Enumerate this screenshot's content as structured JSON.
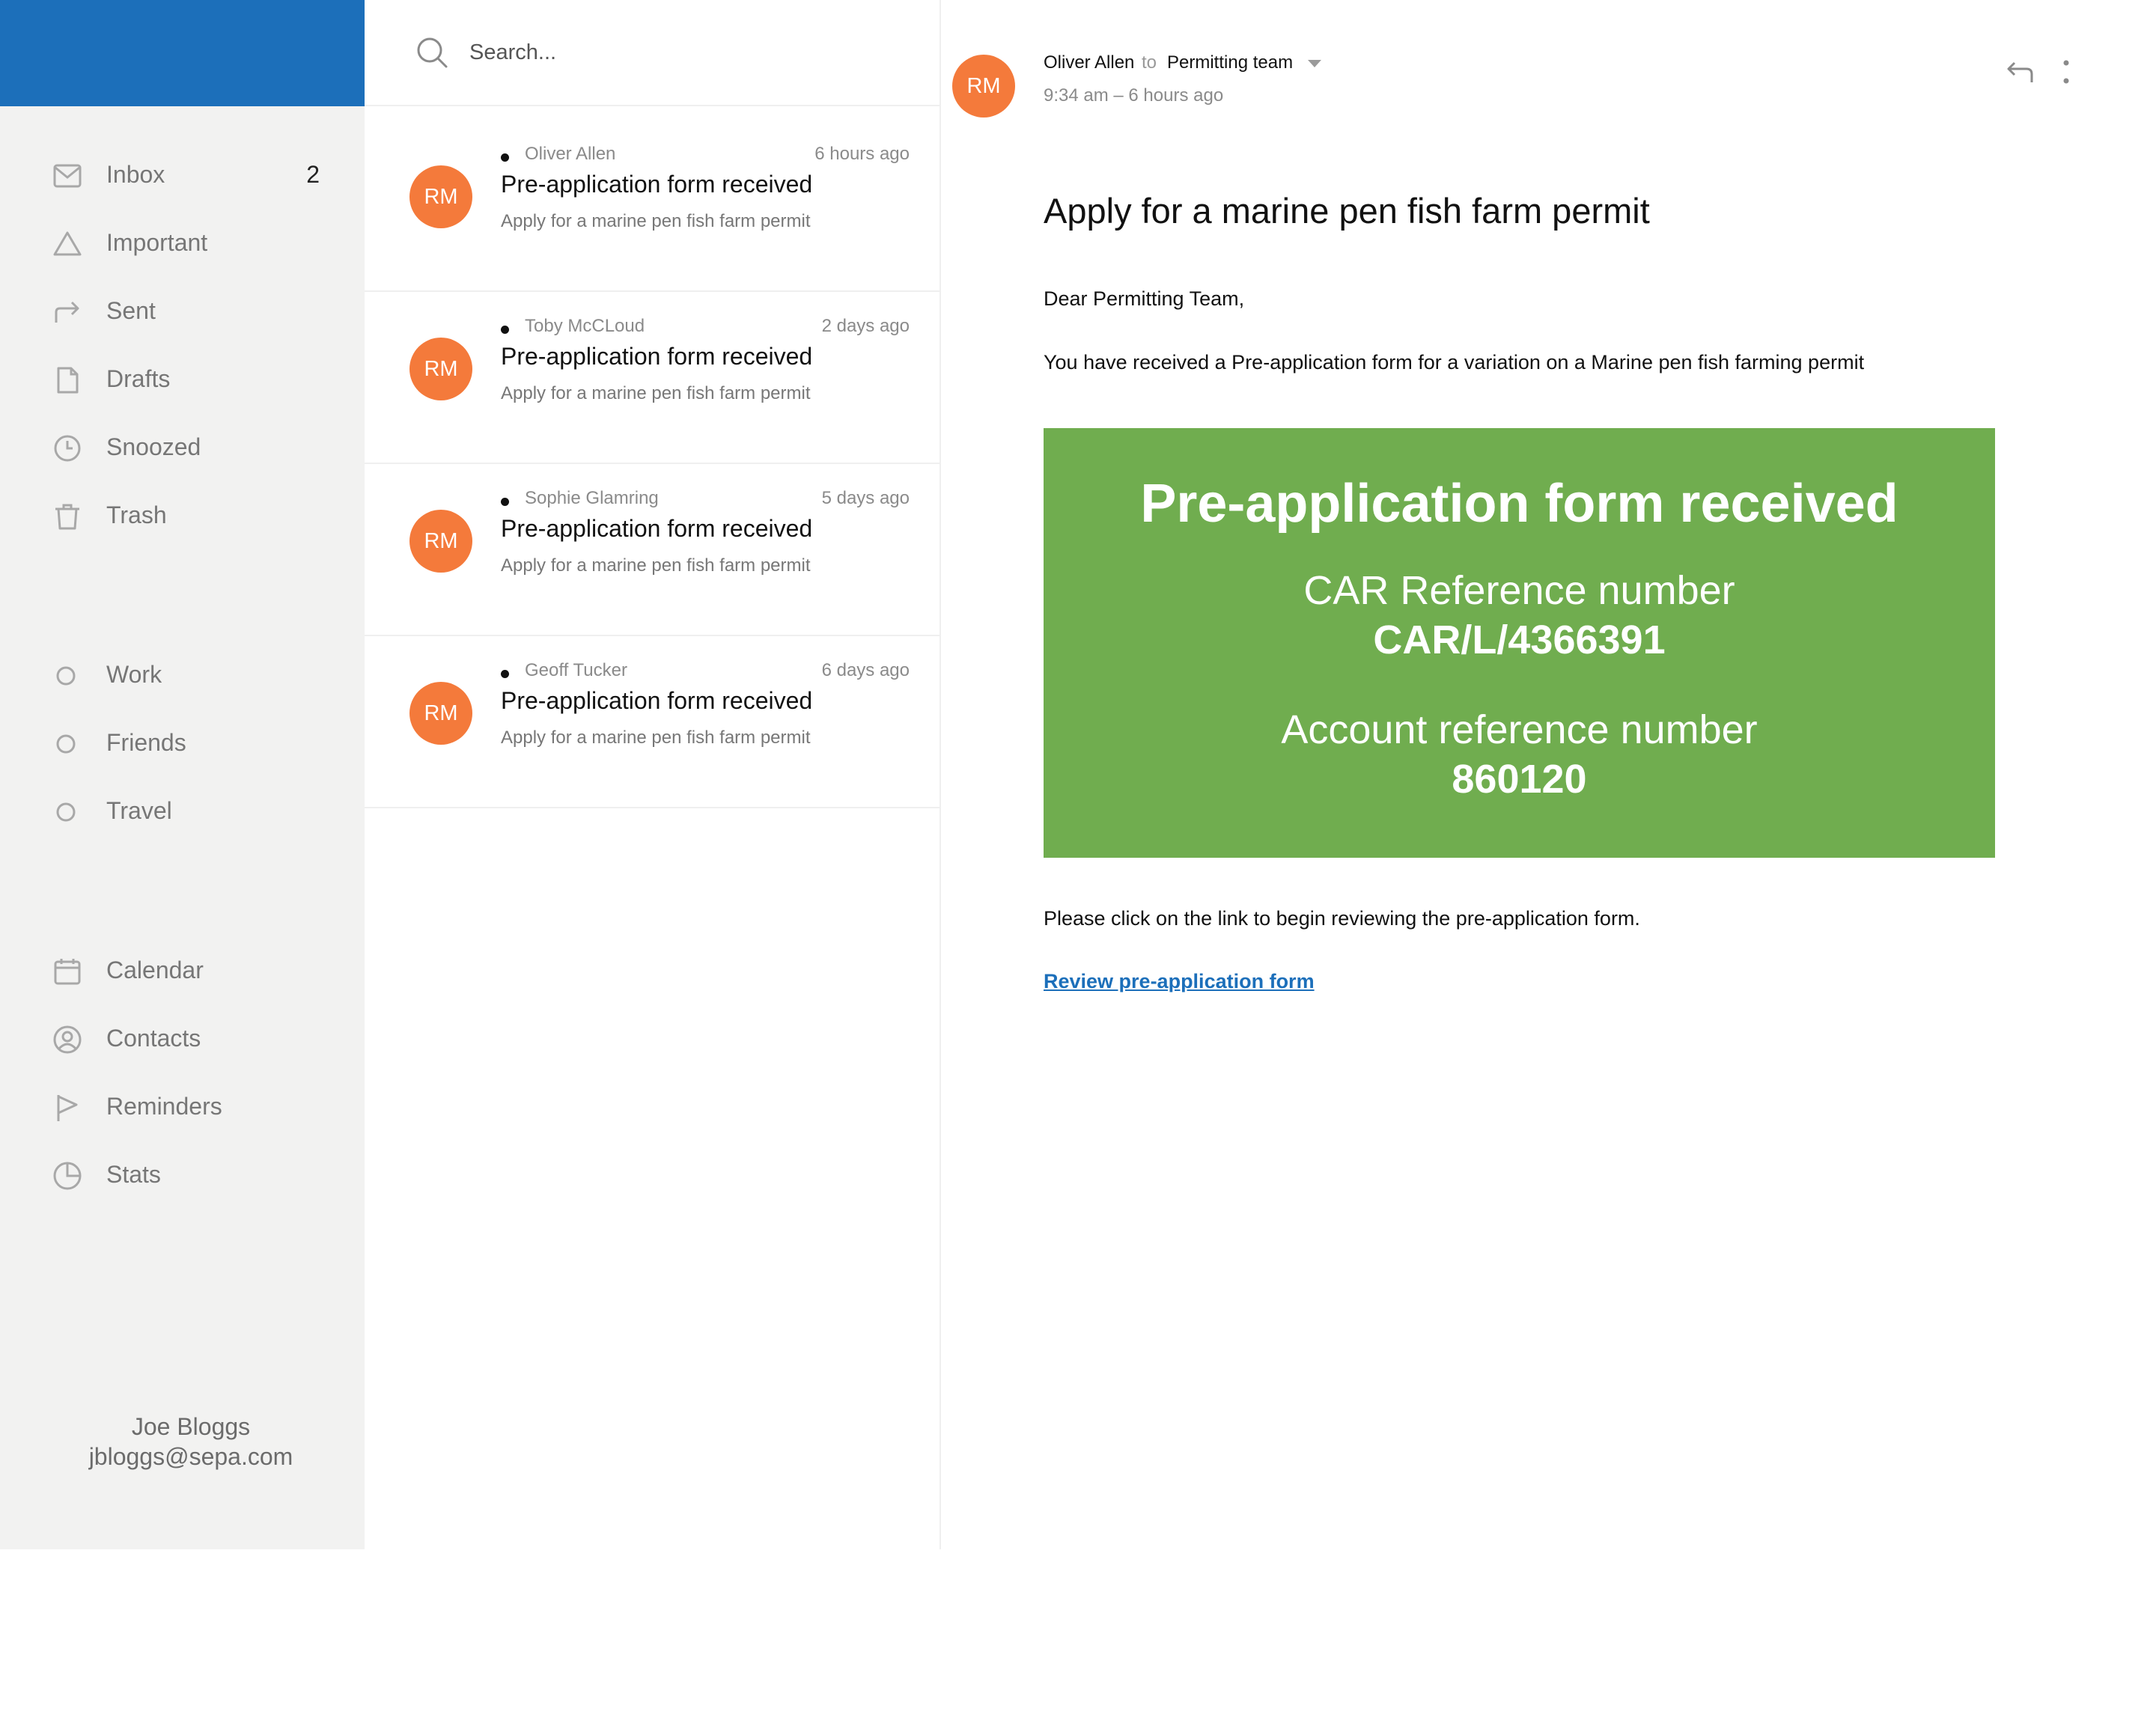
{
  "colors": {
    "brand": "#1c6fba",
    "sidebar_bg": "#f2f2f1",
    "avatar": "#f47a3b",
    "banner": "#70ad4f"
  },
  "sidebar": {
    "items": [
      {
        "label": "Inbox",
        "icon": "mail-icon",
        "count": "2"
      },
      {
        "label": "Important",
        "icon": "triangle-icon"
      },
      {
        "label": "Sent",
        "icon": "forward-arrow-icon"
      },
      {
        "label": "Drafts",
        "icon": "document-icon"
      },
      {
        "label": "Snoozed",
        "icon": "clock-icon"
      },
      {
        "label": "Trash",
        "icon": "trash-icon"
      }
    ],
    "labels": [
      {
        "label": "Work",
        "icon": "circle-icon"
      },
      {
        "label": "Friends",
        "icon": "circle-icon"
      },
      {
        "label": "Travel",
        "icon": "circle-icon"
      }
    ],
    "tools": [
      {
        "label": "Calendar",
        "icon": "calendar-icon"
      },
      {
        "label": "Contacts",
        "icon": "contact-icon"
      },
      {
        "label": "Reminders",
        "icon": "flag-icon"
      },
      {
        "label": "Stats",
        "icon": "pie-chart-icon"
      }
    ],
    "user": {
      "name": "Joe Bloggs",
      "email": "jbloggs@sepa.com"
    }
  },
  "search": {
    "placeholder": "Search..."
  },
  "messages": [
    {
      "avatar": "RM",
      "sender": "Oliver Allen",
      "time": "6 hours ago",
      "subject": "Pre-application form received",
      "preview": "Apply for a marine pen fish farm permit"
    },
    {
      "avatar": "RM",
      "sender": "Toby McCLoud",
      "time": "2 days ago",
      "subject": "Pre-application form received",
      "preview": "Apply for a marine pen fish farm permit"
    },
    {
      "avatar": "RM",
      "sender": "Sophie Glamring",
      "time": "5 days ago",
      "subject": "Pre-application form received",
      "preview": "Apply for a marine pen fish farm permit"
    },
    {
      "avatar": "RM",
      "sender": "Geoff Tucker",
      "time": "6 days ago",
      "subject": "Pre-application form received",
      "preview": "Apply for a marine pen fish farm permit"
    }
  ],
  "reader": {
    "avatar": "RM",
    "from": "Oliver Allen",
    "to_word": "to",
    "to": "Permitting team",
    "time": "9:34 am – 6 hours ago",
    "title": "Apply for a marine pen fish farm permit",
    "greeting": "Dear Permitting Team,",
    "line1": "You have received a Pre-application form for a variation on a Marine pen fish farming permit",
    "banner": {
      "title": "Pre-application form received",
      "car_label": "CAR Reference number",
      "car_value": "CAR/L/4366391",
      "acc_label": "Account reference number",
      "acc_value": "860120"
    },
    "line2": "Please click on the link to begin reviewing the pre-application form.",
    "link": "Review pre-application form"
  }
}
